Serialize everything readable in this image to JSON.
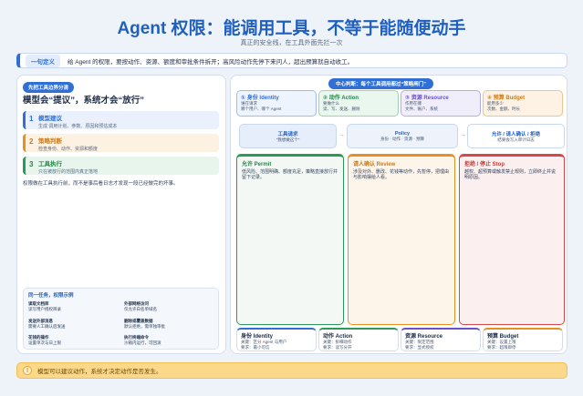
{
  "header": {
    "title": "Agent 权限：能调用工具，不等于能随便动手",
    "subtitle": "真正的安全线，在工具外面先拦一次"
  },
  "definition": {
    "tag": "一句定义",
    "text": "给 Agent 的权限，要按动作、资源、额度和审批条件拆开；高风险动作先停下来问人，超出预算就自动收工。"
  },
  "left": {
    "pill": "先把工具边界分清",
    "question": "模型会“提议”，系统才会“放行”",
    "steps": [
      {
        "num": "1",
        "title": "模型建议",
        "desc": "生成 调用计划、参数、原因和预估成本"
      },
      {
        "num": "2",
        "title": "策略判断",
        "desc": "检查身份、动作、资源和额度"
      },
      {
        "num": "3",
        "title": "工具执行",
        "desc": "只在被放行的范围内真正落地"
      }
    ],
    "note": "权限做在工具执行前，而不是事后看日志才发现一段已经做完的坏事。",
    "mini": {
      "heading": "同一任务，权限示例",
      "cells": [
        {
          "a": "读取文档库",
          "b": "读写用户授权目录"
        },
        {
          "a": "外部网络访问",
          "b": "仅允许白名单域名"
        },
        {
          "a": "发送外部消息",
          "b": "需要人工确认后发送"
        },
        {
          "a": "删除或覆盖数据",
          "b": "默认拒绝，需单独审批"
        },
        {
          "a": "花钱的操作",
          "b": "设置单次与日上限"
        },
        {
          "a": "执行终端命令",
          "b": "沙箱内运行，可回滚"
        }
      ]
    }
  },
  "right": {
    "pill": "中心判断：每个工具调用都过“策略闸门”",
    "dimensions": [
      {
        "title": "① 身份 Identity",
        "l1": "谁在请求",
        "l2": "哪个用户、哪个 Agent"
      },
      {
        "title": "② 动作 Action",
        "l1": "要做什么",
        "l2": "读、写、发送、删除"
      },
      {
        "title": "③ 资源 Resource",
        "l1": "作用在哪",
        "l2": "文件、账户、系统"
      },
      {
        "title": "④ 预算 Budget",
        "l1": "能用多少",
        "l2": "次数、金额、时长"
      }
    ],
    "flow": [
      {
        "title": "工具请求",
        "desc": "“我想做这个”"
      },
      {
        "title": "Policy",
        "desc": "身份 · 动作 · 资源 · 预算"
      },
      {
        "title": "允许 / 请人确认 / 拒绝",
        "desc": "结果会写入审计日志"
      }
    ],
    "columns": [
      {
        "title": "允许 Permit",
        "desc": "低风险、范围明确、额度充足，策略直接放行并留下记录。"
      },
      {
        "title": "请人确认 Review",
        "desc": "涉及对外、删改、花钱等动作，先暂停，把理由与影响摆给人看。"
      },
      {
        "title": "拒绝 / 停止 Stop",
        "desc": "越权、超预算或触发禁止规则，立即终止并说明原因。"
      }
    ],
    "bottom": [
      {
        "title": "身份 Identity",
        "l1": "关键：区分 Agent 与用户",
        "l2": "要求：最小可信"
      },
      {
        "title": "动作 Action",
        "l1": "关键：拆细动作",
        "l2": "要求：读写分开"
      },
      {
        "title": "资源 Resource",
        "l1": "关键：限定范围",
        "l2": "要求：显式授权"
      },
      {
        "title": "预算 Budget",
        "l1": "关键：设置上限",
        "l2": "要求：超限即停"
      }
    ]
  },
  "footer": {
    "icon": "!",
    "text": "模型可以建议动作，系统才决定动作是否发生。"
  }
}
